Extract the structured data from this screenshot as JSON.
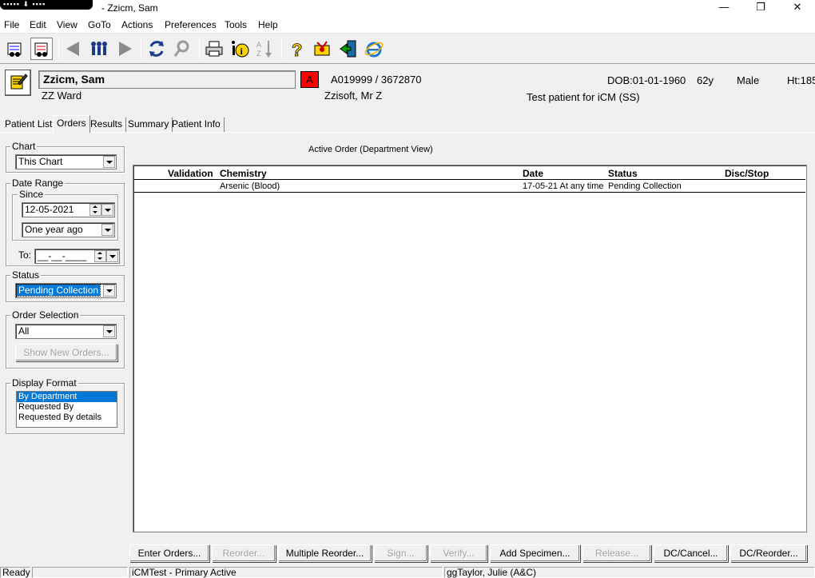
{
  "window": {
    "title": "- Zzicm, Sam",
    "controls": {
      "minimize": "—",
      "restore": "❐",
      "close": "✕"
    }
  },
  "menu": [
    "File",
    "Edit",
    "View",
    "GoTo",
    "Actions",
    "Preferences",
    "Tools",
    "Help"
  ],
  "toolbar": {
    "icons": [
      "find-patient-icon",
      "patient-list-icon",
      "back-arrow-icon",
      "people-icon",
      "forward-arrow-icon",
      "refresh-icon",
      "search-icon",
      "print-icon",
      "info-icon",
      "sort-icon",
      "help-icon",
      "settings-icon",
      "exit-door-icon",
      "internet-explorer-icon"
    ]
  },
  "patient": {
    "name": "Zzicm, Sam",
    "ward": "ZZ Ward",
    "allergy_flag": "A",
    "mrn": "A019999 / 3672870",
    "doctor": "Zzisoft, Mr Z",
    "dob": "DOB:01-01-1960",
    "age": "62y",
    "sex": "Male",
    "height": "Ht:185",
    "comment": "Test patient for iCM (SS)"
  },
  "tabs": [
    "Patient List",
    "Orders",
    "Results",
    "Summary",
    "Patient Info"
  ],
  "active_tab": "Orders",
  "filters": {
    "chart": {
      "label": "Chart",
      "value": "This Chart"
    },
    "date_range": {
      "label": "Date Range",
      "since_label": "Since",
      "since_date": "12-05-2021",
      "since_preset": "One year ago",
      "to_label": "To:",
      "to_value": "__-__-____"
    },
    "status": {
      "label": "Status",
      "value": "Pending Collection"
    },
    "order_selection": {
      "label": "Order Selection",
      "value": "All",
      "show_new_button": "Show New Orders..."
    },
    "display_format": {
      "label": "Display Format",
      "options": [
        "By Department",
        "Requested By",
        "Requested By details"
      ],
      "selected": "By Department"
    }
  },
  "grid": {
    "title": "Active Order (Department View)",
    "columns": [
      "Validation",
      "Chemistry",
      "Date",
      "Status",
      "Disc/Stop"
    ],
    "rows": [
      {
        "validation": "",
        "item": "Arsenic (Blood)",
        "date": "17-05-21 At any time",
        "status": "Pending Collection",
        "disc_stop": ""
      }
    ]
  },
  "actions": [
    {
      "label": "Enter Orders...",
      "enabled": true
    },
    {
      "label": "Reorder...",
      "enabled": false
    },
    {
      "label": "Multiple Reorder...",
      "enabled": true
    },
    {
      "label": "Sign...",
      "enabled": false
    },
    {
      "label": "Verify...",
      "enabled": false
    },
    {
      "label": "Add Specimen...",
      "enabled": true
    },
    {
      "label": "Release...",
      "enabled": false
    },
    {
      "label": "DC/Cancel...",
      "enabled": true
    },
    {
      "label": "DC/Reorder...",
      "enabled": true
    }
  ],
  "statusbar": {
    "state": "Ready",
    "blank": "",
    "system": "iCMTest - Primary Active",
    "user": "ggTaylor, Julie  (A&C)"
  },
  "colors": {
    "selection": "#0078d7",
    "allergy": "#ff0000"
  }
}
